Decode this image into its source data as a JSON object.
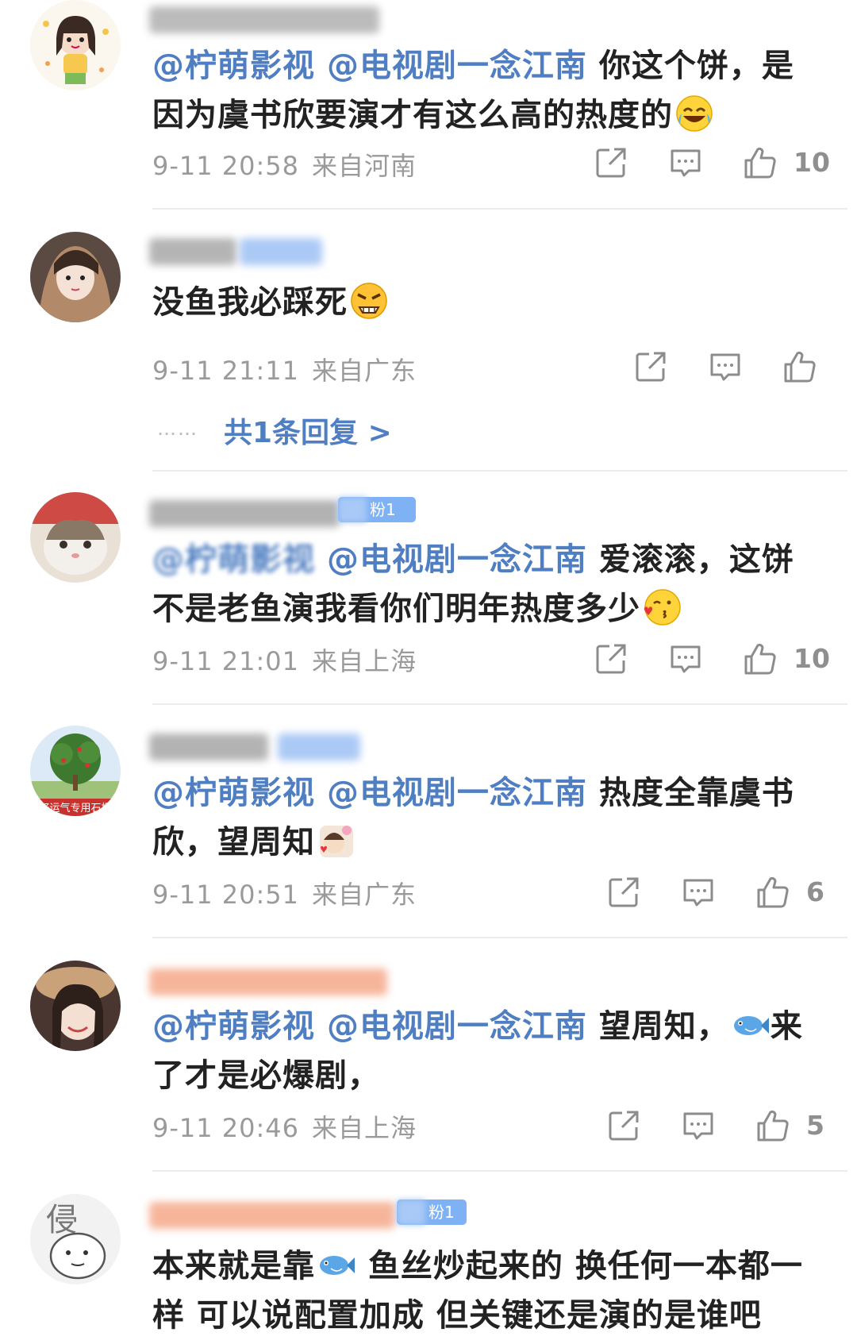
{
  "comments": [
    {
      "mentions": [
        "@柠萌影视",
        "@电视剧一念江南"
      ],
      "text_line1_tail": "你这个饼，是",
      "text_line2": "因为虞书欣要演才有这么高的热度的",
      "emoji": "laughing-tears-emoji",
      "time": "9-11 20:58",
      "location": "来自河南",
      "likes": "10"
    },
    {
      "text_line1": "没鱼我必踩死",
      "emoji": "angry-emoji",
      "time": "9-11 21:11",
      "location": "来自广东",
      "likes": "",
      "replies": "共1条回复 >",
      "replies_dots": "……"
    },
    {
      "badge": "粉1",
      "mentions": [
        "@柠萌影视",
        "@电视剧一念江南"
      ],
      "text_line1_tail": "爱滚滚，这饼",
      "text_line2": "不是老鱼演我看你们明年热度多少",
      "emoji": "kiss-emoji",
      "time": "9-11 21:01",
      "location": "来自上海",
      "likes": "10",
      "avatar_caption": "好运气专用石榴"
    },
    {
      "mentions": [
        "@柠萌影视",
        "@电视剧一念江南"
      ],
      "text_line1_tail": "热度全靠虞书",
      "text_line2": "欣，望周知",
      "emoji": "sticker-emoji",
      "time": "9-11 20:51",
      "location": "来自广东",
      "likes": "6"
    },
    {
      "mentions": [
        "@柠萌影视",
        "@电视剧一念江南"
      ],
      "text_line1_tail": "望周知，",
      "text_line1_after_emoji": "来",
      "text_line2": "了才是必爆剧，",
      "emoji": "fish-emoji",
      "time": "9-11 20:46",
      "location": "来自上海",
      "likes": "5"
    },
    {
      "badge": "粉1",
      "text_line1_head": "本来就是靠",
      "text_line1_tail": "鱼丝炒起来的 换任何一本都一",
      "text_line2": "样 可以说配置加成 但关键还是演的是谁吧",
      "emoji": "fish-emoji",
      "avatar_caption": "侵"
    }
  ],
  "colors": {
    "mention": "#4f7fc2",
    "meta": "#9a9a9a",
    "text": "#222222",
    "badge": "#7fb2f5"
  },
  "icons": [
    "share-icon",
    "comment-icon",
    "like-icon"
  ]
}
